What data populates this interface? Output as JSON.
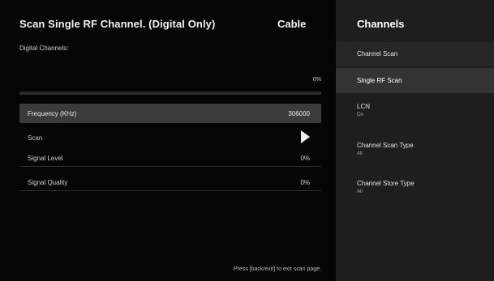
{
  "scan_panel": {
    "title": "Scan Single RF Channel. (Digital Only)",
    "source": "Cable",
    "section_label": "Digital Channels:",
    "progress_percent": "0%",
    "progress_fraction": 0,
    "rows": {
      "frequency": {
        "label": "Frequency (KHz)",
        "value": "306000"
      },
      "scan": {
        "label": "Scan",
        "icon": "play-icon"
      },
      "signal_level": {
        "label": "Signal Level",
        "value": "0%"
      },
      "signal_quality": {
        "label": "Signal Quality",
        "value": "0%"
      }
    },
    "footer_hint": "Press [back/exit] to exit scan page."
  },
  "menu": {
    "title": "Channels",
    "items": [
      {
        "label": "Channel Scan"
      },
      {
        "label": "Single RF Scan",
        "selected": true
      },
      {
        "label": "LCN",
        "value": "On"
      },
      {
        "label": "Channel Scan Type",
        "value": "All"
      },
      {
        "label": "Channel Store Type",
        "value": "All"
      }
    ]
  },
  "colors": {
    "background": "#050505",
    "menu_background": "#1e1e1e",
    "highlight_row": "#3b3b3b",
    "selected_menu_item": "#333333"
  }
}
